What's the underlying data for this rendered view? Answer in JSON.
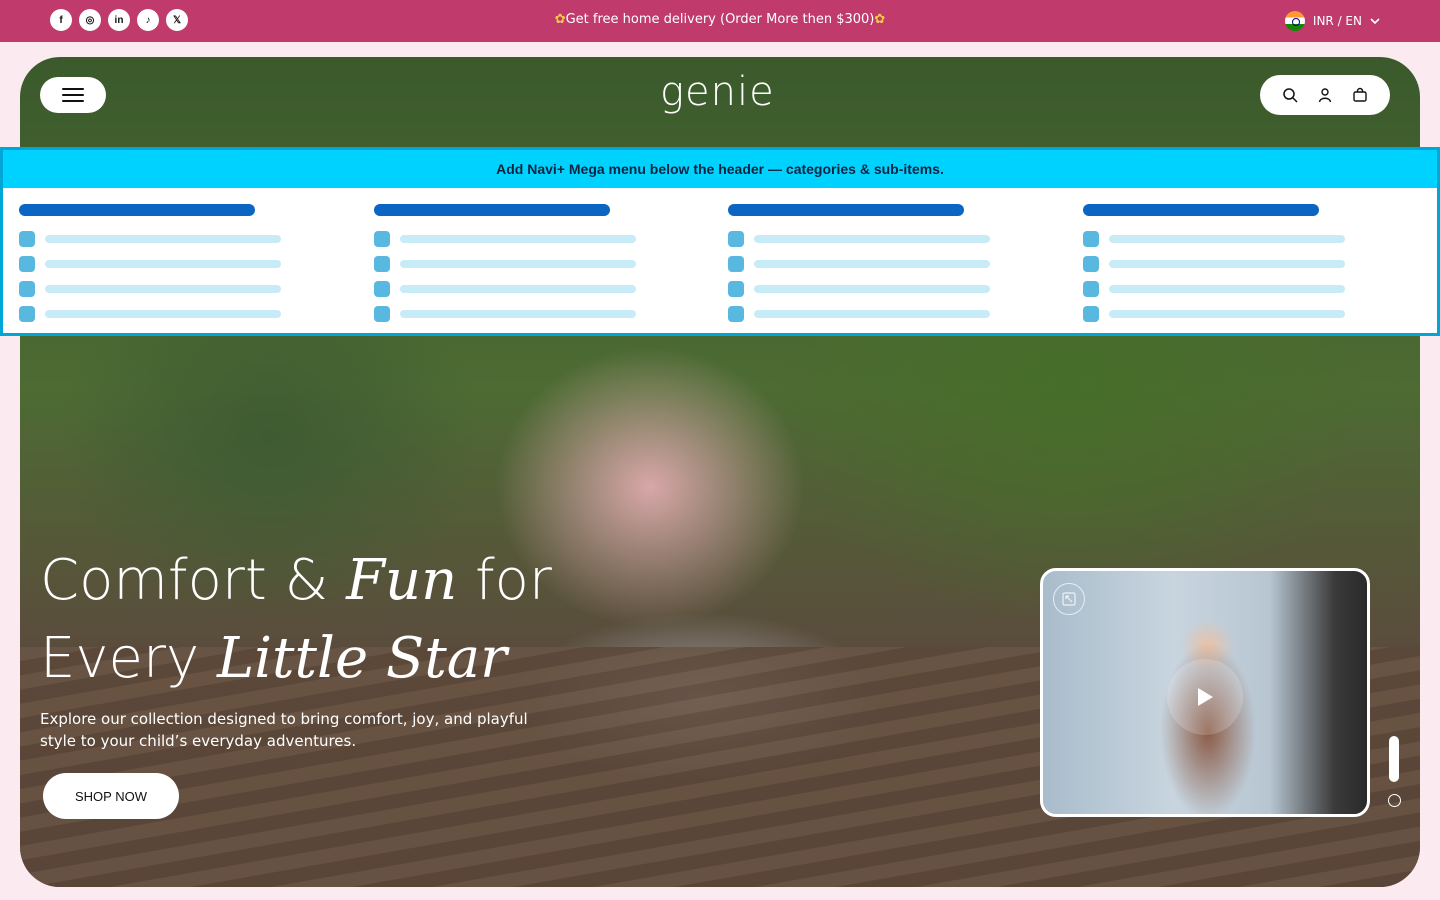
{
  "announcement": {
    "social": [
      "f",
      "◎",
      "in",
      "♪",
      "𝕏"
    ],
    "social_icons": [
      "facebook-icon",
      "instagram-icon",
      "linkedin-icon",
      "tiktok-icon",
      "x-twitter-icon"
    ],
    "promo_text": "Get free home delivery (Order More then $300)",
    "promo_flower": "✿",
    "locale": "INR / EN",
    "locale_chevron": "⌄"
  },
  "header": {
    "logo": "genie",
    "menu_icon": "hamburger-icon",
    "action_icons": [
      "search-icon",
      "user-icon",
      "bag-icon"
    ]
  },
  "mega_menu": {
    "title": "Add Navi+ Mega menu below the header — categories & sub-items."
  },
  "hero": {
    "headline_line1_a": "Comfort & ",
    "headline_line1_em": "Fun",
    "headline_line1_b": " for",
    "headline_line2_a": "Every ",
    "headline_line2_em": "Little Star",
    "subtext": "Explore our collection designed to bring comfort, joy, and playful style to your child’s everyday adventures.",
    "cta": "SHOP NOW"
  },
  "video_card": {
    "expand_icon": "expand-icon",
    "play_icon": "play-icon"
  },
  "colors": {
    "topbar": "#c03a6c",
    "page_bg": "#fbeaf0",
    "mega_header": "#00d2ff",
    "mega_title_bar": "#0b66c3"
  }
}
